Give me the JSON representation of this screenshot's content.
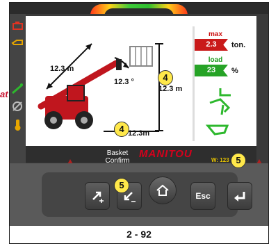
{
  "side_text": "at",
  "screen": {
    "reach_label": "12.3  m",
    "angle_label": "12.3 °",
    "height_label": "12.3 m",
    "base_label": "12.3m",
    "max_label": "max",
    "max_value": "2.3",
    "max_unit": "ton.",
    "load_label": "load",
    "load_value": "23",
    "load_unit": "%"
  },
  "status": {
    "message_line1": "Basket",
    "message_line2": "Confirm",
    "brand": "MANITOU",
    "w_value": "W:  123"
  },
  "callouts": [
    "4",
    "4",
    "5",
    "5"
  ],
  "keys": {
    "esc_label": "Esc",
    "home_icon": "home-icon",
    "up_icon": "arrow-up-plus-icon",
    "down_icon": "arrow-down-minus-icon",
    "enter_icon": "enter-icon"
  },
  "page_number": "2 - 92",
  "colors": {
    "max": "#c91a1a",
    "load": "#26a326",
    "callout": "#ffe84a",
    "brand": "#d6001c"
  }
}
